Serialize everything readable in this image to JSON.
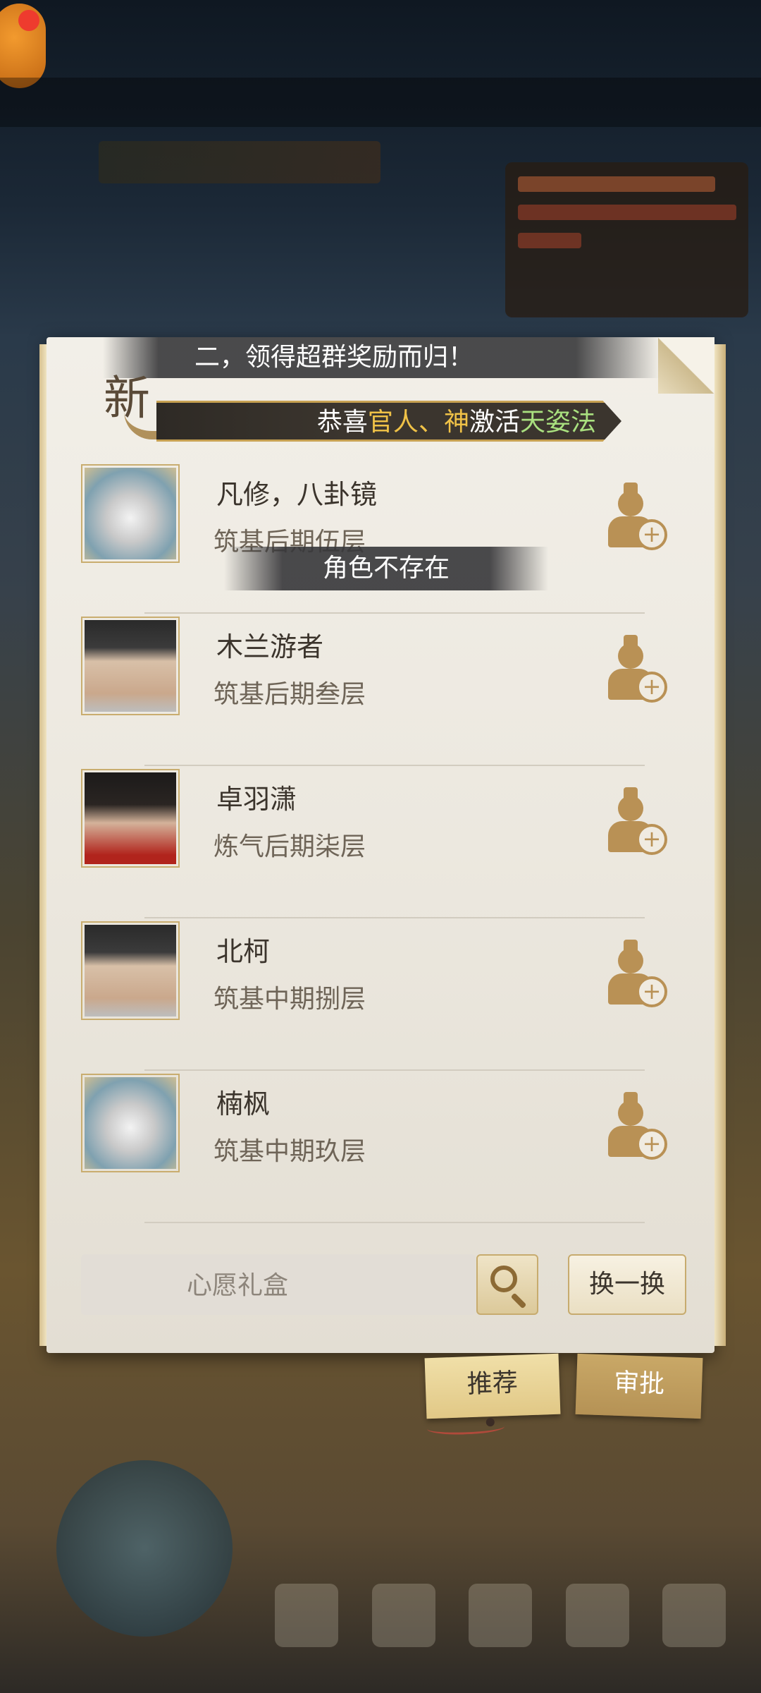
{
  "background": {
    "top_banner_text": "二，领得超群奖励而归！"
  },
  "notice": {
    "badge": "新",
    "prefix": "恭喜",
    "user": "官人",
    "separator": "、",
    "god": "神",
    "action": "激活",
    "item": "天姿法"
  },
  "toast": "角色不存在",
  "players": [
    {
      "name": "凡修，八卦镜",
      "level": "筑基后期伍层",
      "avatar": "beast-avatar"
    },
    {
      "name": "木兰游者",
      "level": "筑基后期叁层",
      "avatar": "man-avatar"
    },
    {
      "name": "卓羽潇",
      "level": "炼气后期柒层",
      "avatar": "dark-hair-avatar"
    },
    {
      "name": "北柯",
      "level": "筑基中期捌层",
      "avatar": "man-avatar"
    },
    {
      "name": "楠枫",
      "level": "筑基中期玖层",
      "avatar": "beast-avatar"
    }
  ],
  "search": {
    "placeholder": "心愿礼盒",
    "value": ""
  },
  "buttons": {
    "swap": "换一换",
    "recommend_tab": "推荐",
    "approve_tab": "审批"
  },
  "colors": {
    "accent_gold": "#f0c247",
    "accent_green": "#a9e07f",
    "icon_brown": "#b99155"
  }
}
